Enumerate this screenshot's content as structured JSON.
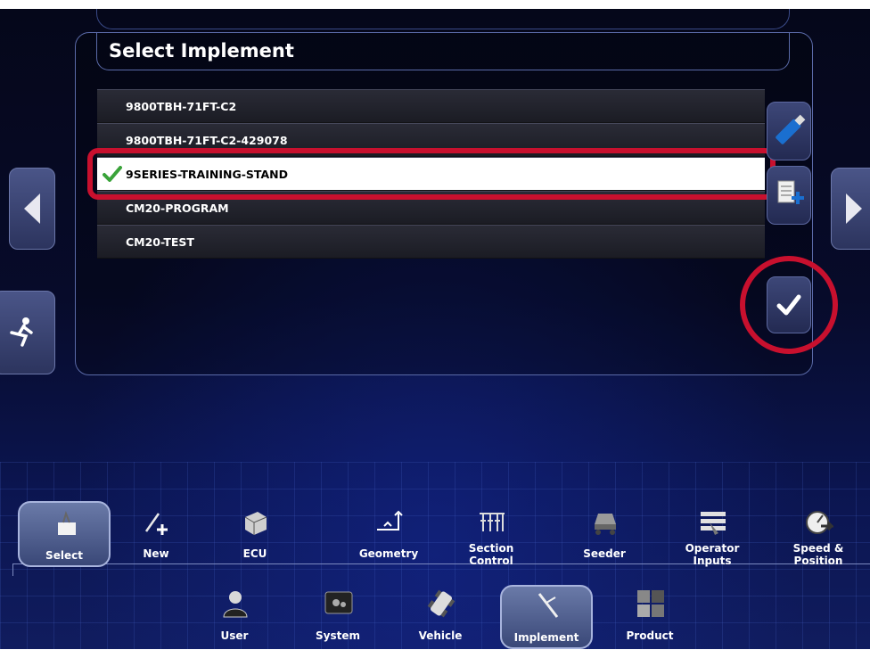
{
  "panel": {
    "title": "Select Implement"
  },
  "implements": [
    {
      "name": "9800TBH-71FT-C2",
      "selected": false
    },
    {
      "name": "9800TBH-71FT-C2-429078",
      "selected": false
    },
    {
      "name": "9SERIES-TRAINING-STAND",
      "selected": true
    },
    {
      "name": "CM20-PROGRAM",
      "selected": false
    },
    {
      "name": "CM20-TEST",
      "selected": false
    }
  ],
  "sub_tabs": [
    {
      "label": "Select",
      "icon": "select-icon",
      "active": true
    },
    {
      "label": "New",
      "icon": "new-implement-icon",
      "active": false
    },
    {
      "label": "ECU",
      "icon": "ecu-icon",
      "active": false
    },
    {
      "label": "Geometry",
      "icon": "geometry-icon",
      "active": false
    },
    {
      "label": "Section Control",
      "line1": "Section",
      "line2": "Control",
      "icon": "section-control-icon",
      "active": false
    },
    {
      "label": "Seeder",
      "icon": "seeder-icon",
      "active": false
    },
    {
      "label": "Operator Inputs",
      "line1": "Operator",
      "line2": "Inputs",
      "icon": "operator-inputs-icon",
      "active": false
    },
    {
      "label": "Speed & Position",
      "line1": "Speed &",
      "line2": "Position",
      "icon": "speed-position-icon",
      "active": false
    }
  ],
  "main_tabs": [
    {
      "label": "User",
      "icon": "user-icon",
      "active": false
    },
    {
      "label": "System",
      "icon": "system-icon",
      "active": false
    },
    {
      "label": "Vehicle",
      "icon": "vehicle-icon",
      "active": false
    },
    {
      "label": "Implement",
      "icon": "implement-icon",
      "active": true
    },
    {
      "label": "Product",
      "icon": "product-icon",
      "active": false
    }
  ],
  "colors": {
    "highlight": "#c8102e",
    "check": "#3aa33a",
    "accent": "#4a5588"
  }
}
